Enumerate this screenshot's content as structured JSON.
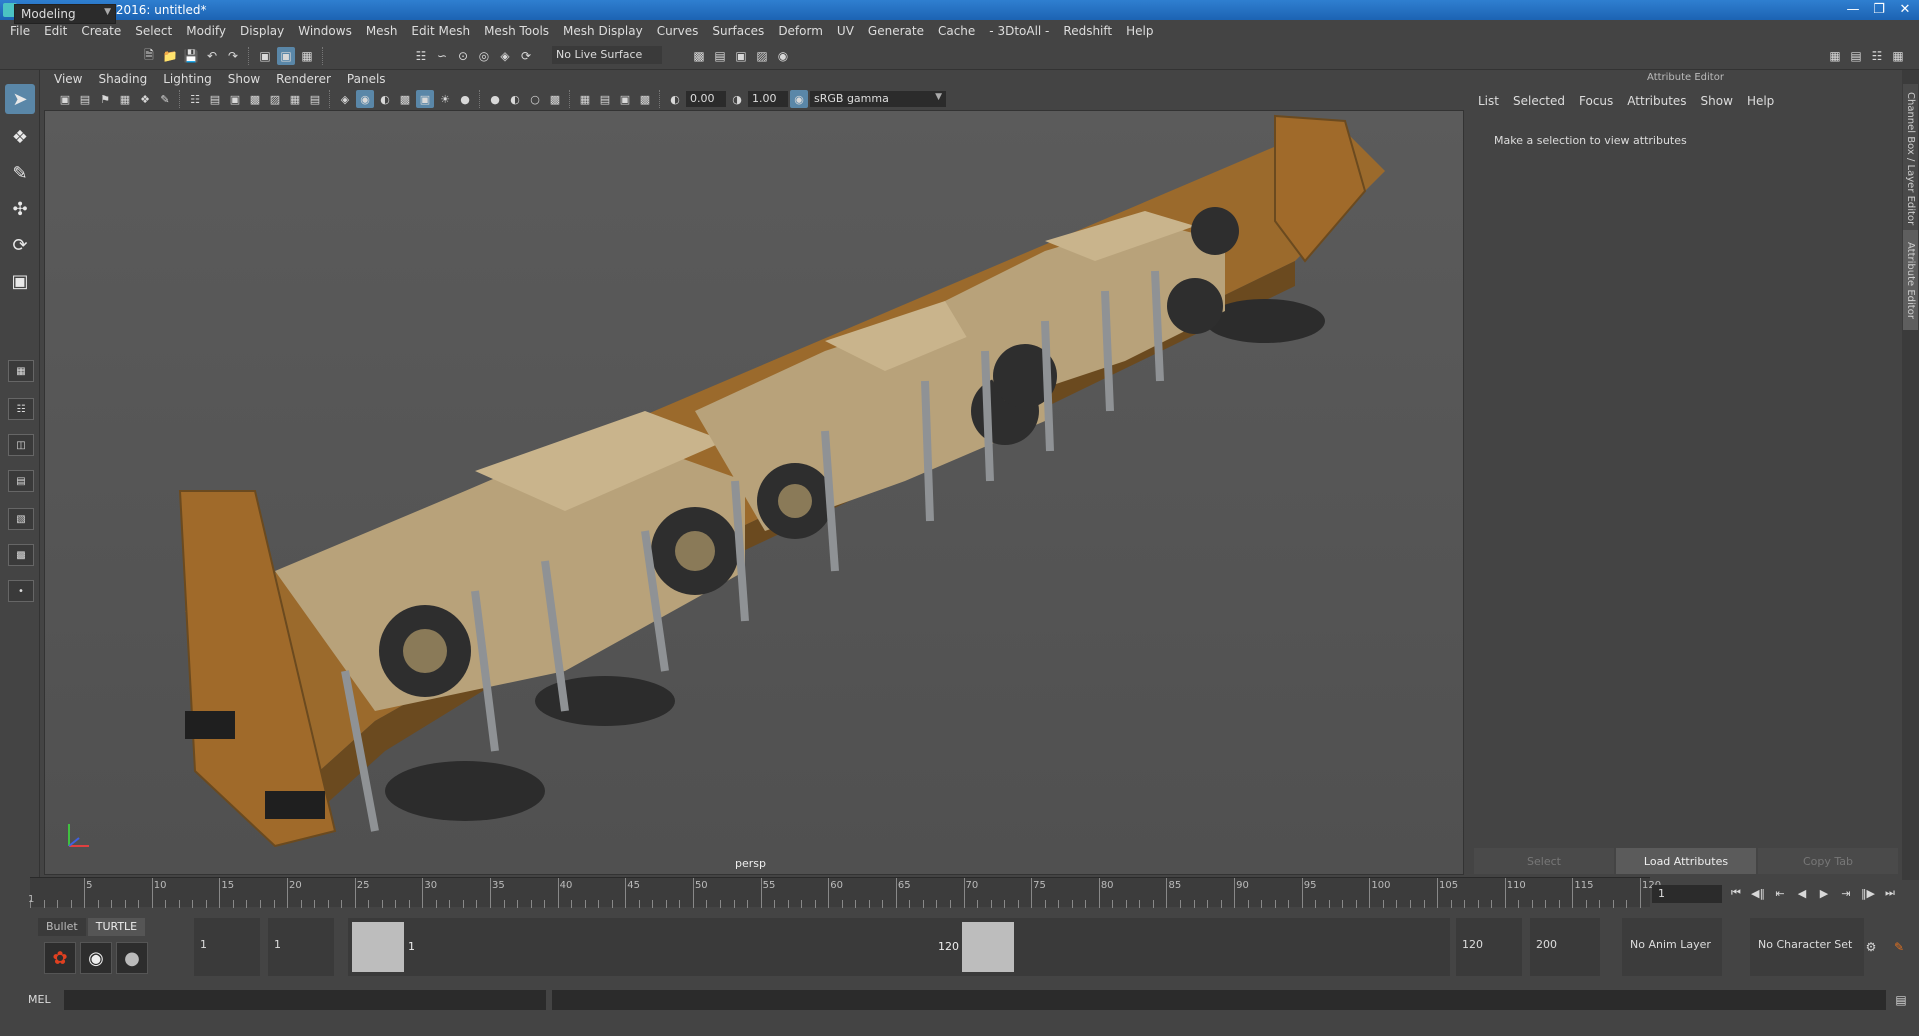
{
  "window": {
    "title": "Autodesk Maya 2016: untitled*"
  },
  "menubar": [
    "File",
    "Edit",
    "Create",
    "Select",
    "Modify",
    "Display",
    "Windows",
    "Mesh",
    "Edit Mesh",
    "Mesh Tools",
    "Mesh Display",
    "Curves",
    "Surfaces",
    "Deform",
    "UV",
    "Generate",
    "Cache",
    "- 3DtoAll -",
    "Redshift",
    "Help"
  ],
  "statusline": {
    "mode": "Modeling",
    "live_surface": "No Live Surface"
  },
  "panel": {
    "menus": [
      "View",
      "Shading",
      "Lighting",
      "Show",
      "Renderer",
      "Panels"
    ],
    "exposure": "0.00",
    "gamma": "1.00",
    "color_space": "sRGB gamma",
    "camera": "persp"
  },
  "attribute_editor": {
    "title": "Attribute Editor",
    "menus": [
      "List",
      "Selected",
      "Focus",
      "Attributes",
      "Show",
      "Help"
    ],
    "message": "Make a selection to view attributes",
    "buttons": {
      "select": "Select",
      "load": "Load Attributes",
      "copy": "Copy Tab"
    }
  },
  "side_tabs": {
    "channel_box": "Channel Box / Layer Editor",
    "attribute_editor": "Attribute Editor"
  },
  "timeslider": {
    "ticks": [
      5,
      10,
      15,
      20,
      25,
      30,
      35,
      40,
      45,
      50,
      55,
      60,
      65,
      70,
      75,
      80,
      85,
      90,
      95,
      100,
      105,
      110,
      115,
      120
    ],
    "start_label": "1",
    "current_frame": "1"
  },
  "shelf": {
    "tabs": [
      "Bullet",
      "TURTLE"
    ]
  },
  "range": {
    "start": "1",
    "playback_start": "1",
    "range_start_label": "1",
    "range_end_label": "120",
    "playback_end": "120",
    "end": "200",
    "anim_layer": "No Anim Layer",
    "character_set": "No Character Set"
  },
  "cmdline": {
    "label": "MEL"
  }
}
